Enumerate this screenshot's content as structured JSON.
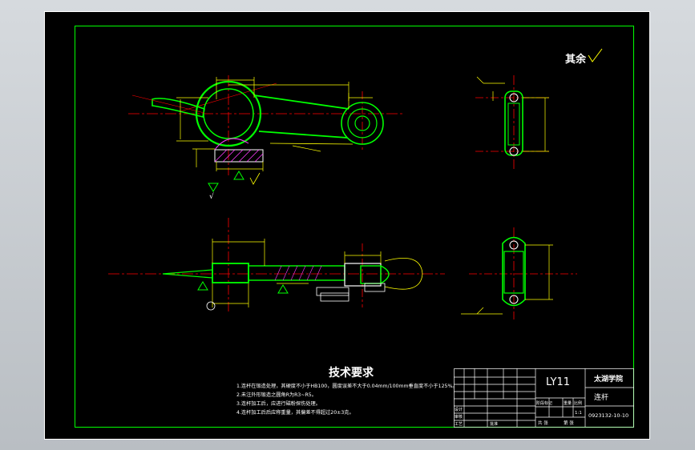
{
  "finish_symbol": {
    "label": "其余",
    "roughness_glyph": "✓"
  },
  "tech_requirements": {
    "title": "技术要求",
    "items": [
      "1.连杆在锻造处理，其硬度不小于HB100，圆度误差不大于0.04mm/100mm垂直度不小于125%。",
      "2.未注外形锻造之圆角R为R3~R5。",
      "3.连杆加工后，应进行磁粉探伤处理。",
      "4.连杆加工后后应称重量，其偏差不得超过20±3克。"
    ]
  },
  "title_block": {
    "drawing_code": "LY11",
    "school": "太湖学院",
    "part_name": "连杆",
    "drawing_number": "0923132-10-10",
    "scale_header": "比例",
    "scale_value": "1:1",
    "weight_header": "重量",
    "stage_header": "阶段标记",
    "count_value": "1",
    "sheet_total_label": "共 张",
    "sheet_label": "第 张",
    "design_label": "设计",
    "check_label": "审核",
    "process_label": "工艺",
    "approve_label": "批准"
  },
  "colors": {
    "frame": "#00ff00",
    "outline": "#ffffff",
    "centerline": "#ff0000",
    "dimension": "#ffff00",
    "hatch": "#ff3cff",
    "part": "#00ff00",
    "sheet_bg": "#000000"
  }
}
